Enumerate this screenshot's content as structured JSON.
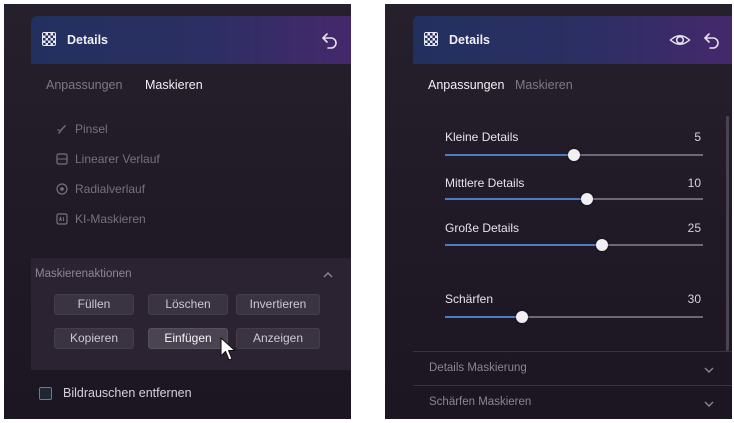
{
  "left_panel": {
    "header": {
      "title": "Details"
    },
    "tabs": [
      {
        "label": "Anpassungen",
        "active": false
      },
      {
        "label": "Maskieren",
        "active": true
      }
    ],
    "mask_tools": [
      {
        "label": "Pinsel",
        "icon": "brush-icon"
      },
      {
        "label": "Linearer Verlauf",
        "icon": "linear-gradient-icon"
      },
      {
        "label": "Radialverlauf",
        "icon": "radial-gradient-icon"
      },
      {
        "label": "KI-Maskieren",
        "icon": "ai-mask-icon"
      }
    ],
    "mask_actions": {
      "title": "Maskierenaktionen",
      "buttons": [
        {
          "label": "Füllen"
        },
        {
          "label": "Löschen"
        },
        {
          "label": "Invertieren"
        },
        {
          "label": "Kopieren"
        },
        {
          "label": "Einfügen",
          "pressed": true
        },
        {
          "label": "Anzeigen"
        }
      ]
    },
    "checkbox": {
      "label": "Bildrauschen entfernen",
      "checked": false
    }
  },
  "right_panel": {
    "header": {
      "title": "Details"
    },
    "tabs": [
      {
        "label": "Anpassungen",
        "active": true
      },
      {
        "label": "Maskieren",
        "active": false
      }
    ],
    "sliders": [
      {
        "label": "Kleine Details",
        "value": "5",
        "level": 0.5
      },
      {
        "label": "Mittlere Details",
        "value": "10",
        "level": 0.55
      },
      {
        "label": "Große Details",
        "value": "25",
        "level": 0.61
      },
      {
        "label": "Schärfen",
        "value": "30",
        "level": 0.3
      }
    ],
    "sections": [
      {
        "label": "Details Maskierung"
      },
      {
        "label": "Schärfen Maskieren"
      }
    ]
  },
  "colors": {
    "accent": "#4d7cc0",
    "panel_bg": "#231c29",
    "header_start": "#22305f",
    "header_end": "#45286c"
  }
}
